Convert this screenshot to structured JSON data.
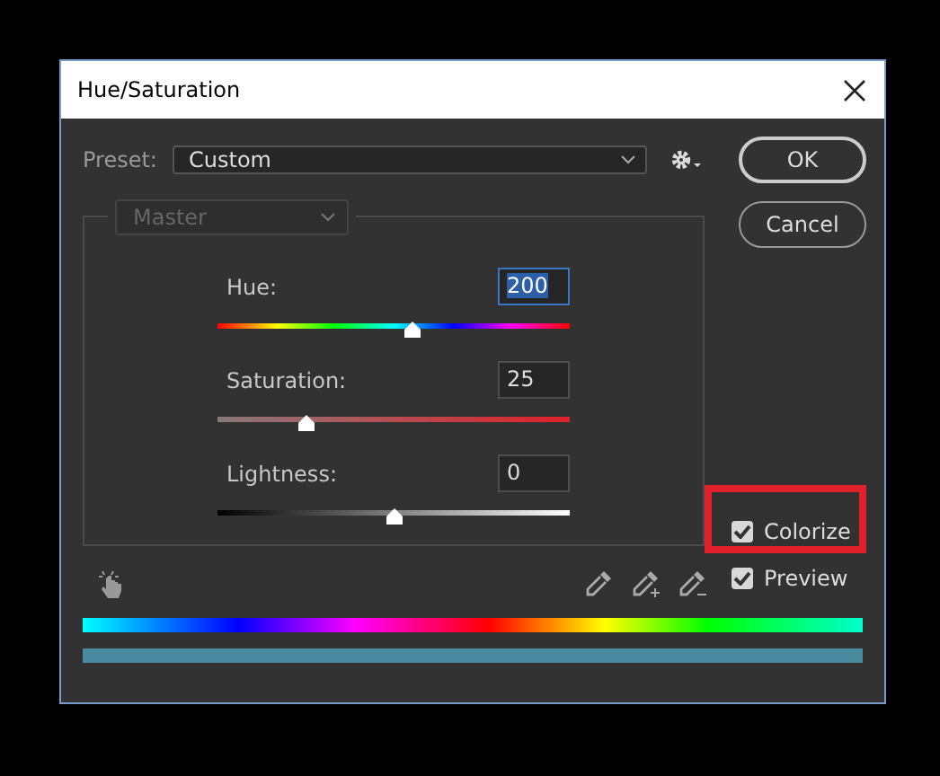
{
  "window": {
    "title": "Hue/Saturation"
  },
  "preset": {
    "label": "Preset:",
    "value": "Custom"
  },
  "channel": {
    "value": "Master",
    "disabled": true
  },
  "adjustments": [
    {
      "label": "Hue:",
      "value": "200",
      "focused": true,
      "level": 0.55,
      "kind": "hue"
    },
    {
      "label": "Saturation:",
      "value": "25",
      "focused": false,
      "level": 0.25,
      "kind": "saturation"
    },
    {
      "label": "Lightness:",
      "value": "0",
      "focused": false,
      "level": 0.5,
      "kind": "lightness"
    }
  ],
  "buttons": [
    {
      "label": "OK",
      "default": true
    },
    {
      "label": "Cancel",
      "default": false
    }
  ],
  "options": [
    {
      "label": "Colorize",
      "checked": true,
      "highlighted": true
    },
    {
      "label": "Preview",
      "checked": true,
      "highlighted": false
    }
  ]
}
